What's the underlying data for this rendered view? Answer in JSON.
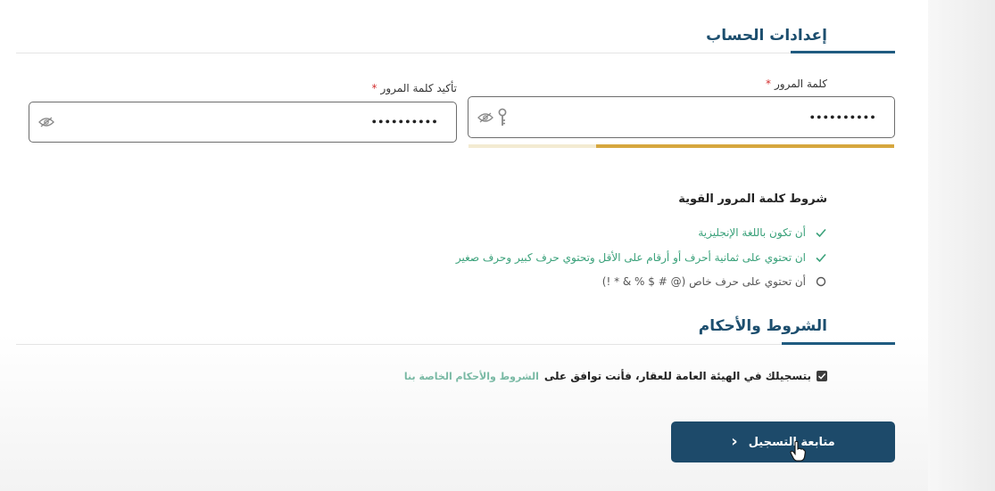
{
  "account_section": {
    "title": "إعدادات الحساب"
  },
  "password": {
    "label": "كلمة المرور",
    "required_mark": "*",
    "value": "••••••••••",
    "strength": 0.7
  },
  "confirm_password": {
    "label": "تأكيد كلمة المرور",
    "required_mark": "*",
    "value": "••••••••••"
  },
  "rules": {
    "title": "شروط كلمة المرور القوية",
    "items": [
      {
        "text": "أن تكون باللغة الإنجليزية",
        "status": "ok"
      },
      {
        "text": "ان تحتوي على ثمانية أحرف أو أرقام على الأقل وتحتوي حرف كبير وحرف صغير",
        "status": "ok"
      },
      {
        "text": "أن تحتوي على حرف خاص (@ # $ % & * !)",
        "status": "pending"
      }
    ]
  },
  "terms_section": {
    "title": "الشروط والأحكام",
    "agreement_text": "بتسجيلك في الهيئة العامة للعقار، فأنت توافق على",
    "link_text": "الشروط والأحكام الخاصة بنا",
    "checked": true
  },
  "continue_button": {
    "label": "متابعة التسجيل",
    "chevron": "‹"
  },
  "colors": {
    "primary": "#1d4a6a",
    "success": "#3aa17a",
    "strength": "#d6a73e",
    "required": "#d32f2f"
  },
  "icons": [
    "eye-slash-icon",
    "key-icon",
    "check-icon",
    "circle-icon",
    "checkbox-icon",
    "chevron-left-icon",
    "hand-cursor-icon"
  ]
}
